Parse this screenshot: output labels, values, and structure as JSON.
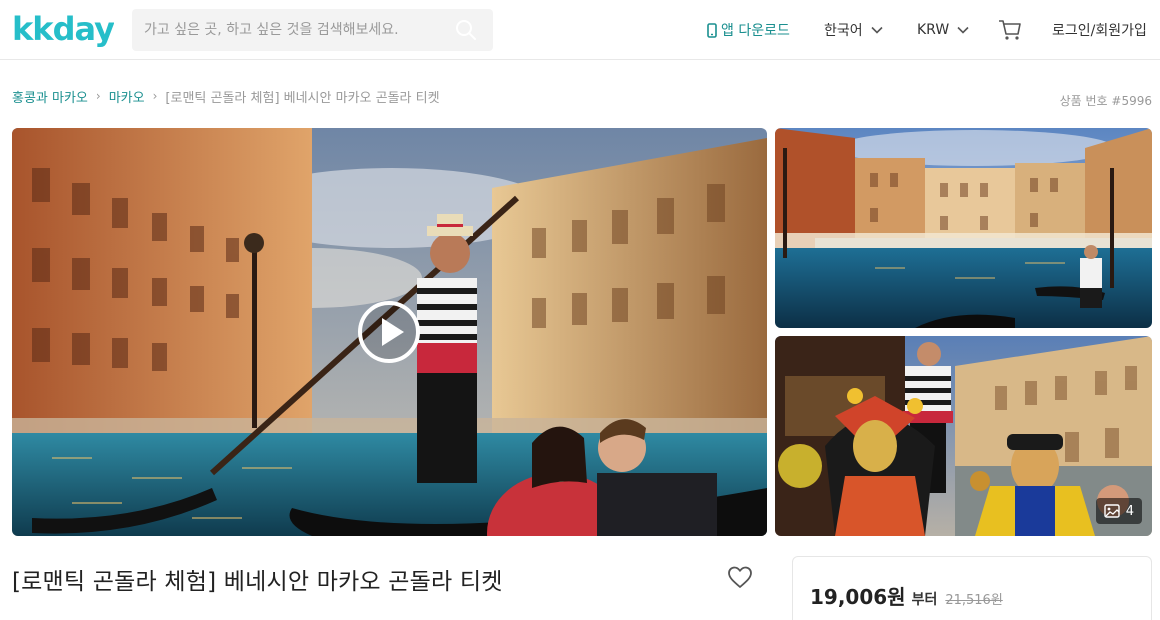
{
  "header": {
    "logo_text": "kkday",
    "search_placeholder": "가고 싶은 곳, 하고 싶은 것을 검색해보세요.",
    "app_download": "앱 다운로드",
    "language": "한국어",
    "currency": "KRW",
    "login": "로그인/회원가입"
  },
  "breadcrumb": {
    "items": [
      "홍콩과 마카오",
      "마카오"
    ],
    "current": "[로맨틱 곤돌라 체험] 베네시안 마카오 곤돌라 티켓"
  },
  "product_number": "상품 번호 #5996",
  "gallery": {
    "photo_count": "4"
  },
  "product": {
    "title": "[로맨틱 곤돌라 체험] 베네시안 마카오 곤돌라 티켓"
  },
  "price": {
    "current": "19,006원",
    "suffix": "부터",
    "original": "21,516원"
  },
  "colors": {
    "brand": "#26bec9",
    "link": "#1a8f8f"
  }
}
